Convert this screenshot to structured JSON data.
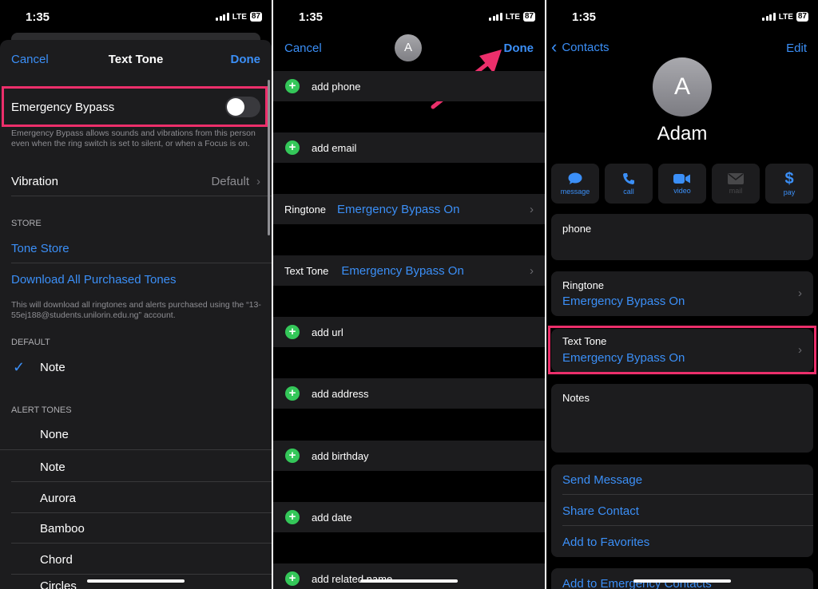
{
  "status": {
    "time": "1:35",
    "network": "LTE",
    "battery": "87"
  },
  "panel1": {
    "nav": {
      "cancel": "Cancel",
      "title": "Text Tone",
      "done": "Done"
    },
    "emergency_bypass": {
      "label": "Emergency Bypass",
      "enabled": false,
      "footer": "Emergency Bypass allows sounds and vibrations from this person even when the ring switch is set to silent, or when a Focus is on."
    },
    "vibration": {
      "label": "Vibration",
      "value": "Default"
    },
    "store_header": "STORE",
    "tone_store": "Tone Store",
    "download_all": "Download All Purchased Tones",
    "download_footer": "This will download all ringtones and alerts purchased using the “13-55ej188@students.unilorin.edu.ng” account.",
    "default_header": "DEFAULT",
    "default_tone": "Note",
    "alert_header": "ALERT TONES",
    "alert_tones": [
      "None",
      "Note",
      "Aurora",
      "Bamboo",
      "Chord",
      "Circles"
    ]
  },
  "panel2": {
    "nav": {
      "cancel": "Cancel",
      "avatar": "A",
      "done": "Done"
    },
    "add_phone": "add phone",
    "add_email": "add email",
    "ringtone": {
      "label": "Ringtone",
      "value": "Emergency Bypass On"
    },
    "text_tone": {
      "label": "Text Tone",
      "value": "Emergency Bypass On"
    },
    "add_url": "add url",
    "add_address": "add address",
    "add_birthday": "add birthday",
    "add_date": "add date",
    "add_related_name": "add related name"
  },
  "panel3": {
    "nav": {
      "back": "Contacts",
      "edit": "Edit"
    },
    "avatar": "A",
    "name": "Adam",
    "actions": [
      {
        "label": "message",
        "icon": "message-icon"
      },
      {
        "label": "call",
        "icon": "phone-icon"
      },
      {
        "label": "video",
        "icon": "video-icon"
      },
      {
        "label": "mail",
        "icon": "mail-icon"
      },
      {
        "label": "pay",
        "icon": "dollar-icon"
      }
    ],
    "phone_label": "phone",
    "ringtone": {
      "label": "Ringtone",
      "value": "Emergency Bypass On"
    },
    "text_tone": {
      "label": "Text Tone",
      "value": "Emergency Bypass On"
    },
    "notes_label": "Notes",
    "links": [
      "Send Message",
      "Share Contact",
      "Add to Favorites"
    ],
    "emergency_link": "Add to Emergency Contacts"
  },
  "colors": {
    "accent": "#3b8ff7",
    "highlight": "#ec2f6b",
    "add_green": "#34c759"
  }
}
